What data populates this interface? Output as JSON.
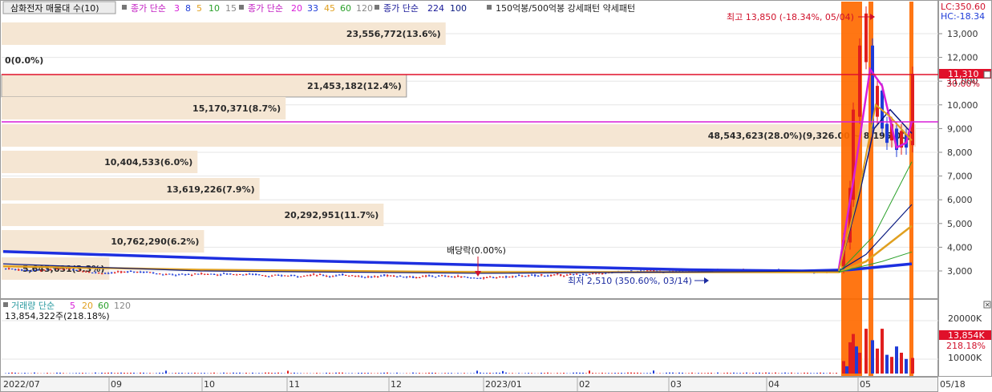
{
  "legend": {
    "title": "삼화전자 매물대 수(10)",
    "ma_short_label": "종가 단순",
    "ma_short_periods": [
      "3",
      "8",
      "5",
      "10",
      "15"
    ],
    "ma_mid_label": "종가 단순",
    "ma_mid_periods": [
      "20",
      "33",
      "45",
      "60",
      "120"
    ],
    "ma_long_label": "종가 단순",
    "ma_long_periods": [
      "224",
      "100"
    ],
    "pattern_label": "150억봉/500억봉 강세패턴 약세패턴"
  },
  "colors": {
    "volume_profile_bar": "#f5e6d3",
    "current_price_line": "#e0102a",
    "magenta_line": "#d81ed8",
    "ma224": "#1d2fe0",
    "orange_band": "#ff6a00",
    "up_candle": "#e01e1e",
    "down_candle": "#1e3cd8",
    "ma_orange": "#e0a020",
    "ma_green": "#2aa02a",
    "ma_navy": "#0a1a80"
  },
  "chart_data": [
    {
      "type": "line",
      "name": "price",
      "x_tick_labels": [
        "2022/07",
        "09",
        "10",
        "11",
        "12",
        "2023/01",
        "02",
        "03",
        "04",
        "05",
        "05/18"
      ],
      "y_tick_labels": [
        "3,000",
        "4,000",
        "5,000",
        "6,000",
        "7,000",
        "8,000",
        "9,000",
        "10,000",
        "11,000",
        "12,000",
        "13,000"
      ],
      "ylim": [
        2000,
        14000
      ],
      "grid": true,
      "current_price_label": "11,310",
      "current_price": 11310,
      "lc_label": "LC:350.60",
      "hc_label": "HC:-18.34",
      "pct_label": "30.00%",
      "magenta_level": 9300,
      "annotations": {
        "high": "최고 13,850 (-18.34%, 05/04)",
        "low": "최저 2,510 (350.60%, 03/14)",
        "dividend": "배당락(0.00%)"
      },
      "volume_profile": [
        {
          "label": "0(0.0%)",
          "pct": 0.0
        },
        {
          "label": "23,556,772(13.6%)",
          "pct": 13.6
        },
        {
          "label": "21,453,182(12.4%)",
          "pct": 12.4
        },
        {
          "label": "15,170,371(8.7%)",
          "pct": 8.7
        },
        {
          "label": "48,543,623(28.0%)(9,326.00 ~ 8,195.00)",
          "pct": 28.0
        },
        {
          "label": "10,404,533(6.0%)",
          "pct": 6.0
        },
        {
          "label": "13,619,226(7.9%)",
          "pct": 7.9
        },
        {
          "label": "20,292,951(11.7%)",
          "pct": 11.7
        },
        {
          "label": "10,762,290(6.2%)",
          "pct": 6.2
        },
        {
          "label": "5,643,631(3.3%)",
          "pct": 3.3
        }
      ]
    },
    {
      "type": "bar",
      "name": "volume",
      "legend_label": "거래량 단순",
      "legend_periods": [
        "5",
        "20",
        "60",
        "120"
      ],
      "readout": "13,854,322주(218.18%)",
      "y_tick_labels": [
        "10000K",
        "20000K"
      ],
      "current_label": "13,854K",
      "current_pct": "218.18%"
    }
  ]
}
